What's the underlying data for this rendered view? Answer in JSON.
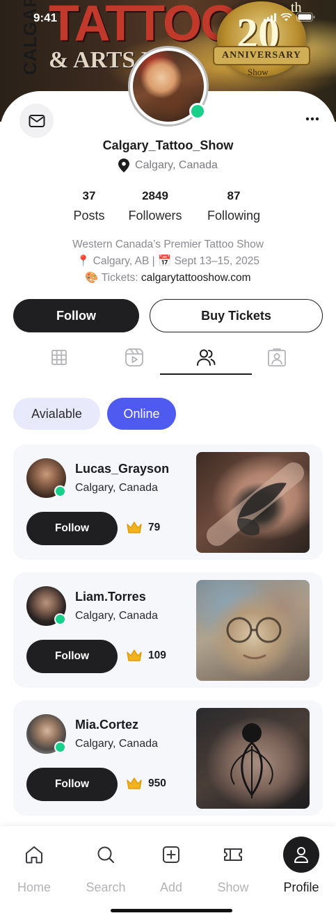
{
  "status_bar": {
    "time": "9:41"
  },
  "banner": {
    "side_text": "CALGARY",
    "title": "TATTOO",
    "subtitle": "& ARTS FES",
    "anniversary_number": "20",
    "anniversary_suffix": "th",
    "anniversary_label": "ANNIVERSARY",
    "anniversary_show": "Show"
  },
  "profile": {
    "username": "Calgary_Tattoo_Show",
    "location": "Calgary, Canada",
    "stats": [
      {
        "value": "37",
        "label": "Posts"
      },
      {
        "value": "2849",
        "label": "Followers"
      },
      {
        "value": "87",
        "label": "Following"
      }
    ],
    "bio_line1": "Western Canada’s Premier Tattoo Show",
    "bio_line2_pin": "📍",
    "bio_line2_city": "Calgary, AB |",
    "bio_line2_cal": "📅",
    "bio_line2_date": "Sept 13–15, 2025",
    "bio_line3_icon": "🎨",
    "bio_line3_label": "Tickets:",
    "bio_line3_link": "calgarytattooshow.com"
  },
  "actions": {
    "follow": "Follow",
    "buy_tickets": "Buy Tickets"
  },
  "tabs": [
    "grid-icon",
    "reels-icon",
    "people-icon",
    "tagged-icon"
  ],
  "filters": {
    "available": "Avialable",
    "online": "Online"
  },
  "artists": [
    {
      "name": "Lucas_Grayson",
      "location": "Calgary, Canada",
      "follow": "Follow",
      "score": "79"
    },
    {
      "name": "Liam.Torres",
      "location": "Calgary, Canada",
      "follow": "Follow",
      "score": "109"
    },
    {
      "name": "Mia.Cortez",
      "location": "Calgary, Canada",
      "follow": "Follow",
      "score": "950"
    }
  ],
  "bottom_nav": [
    {
      "label": "Home",
      "icon": "home-icon"
    },
    {
      "label": "Search",
      "icon": "search-icon"
    },
    {
      "label": "Add",
      "icon": "add-icon"
    },
    {
      "label": "Show",
      "icon": "ticket-icon"
    },
    {
      "label": "Profile",
      "icon": "user-icon",
      "active": true
    }
  ],
  "colors": {
    "accent": "#4f5bf0",
    "online": "#18d08a",
    "dark": "#1f1f21",
    "crown": "#f2b21b"
  }
}
